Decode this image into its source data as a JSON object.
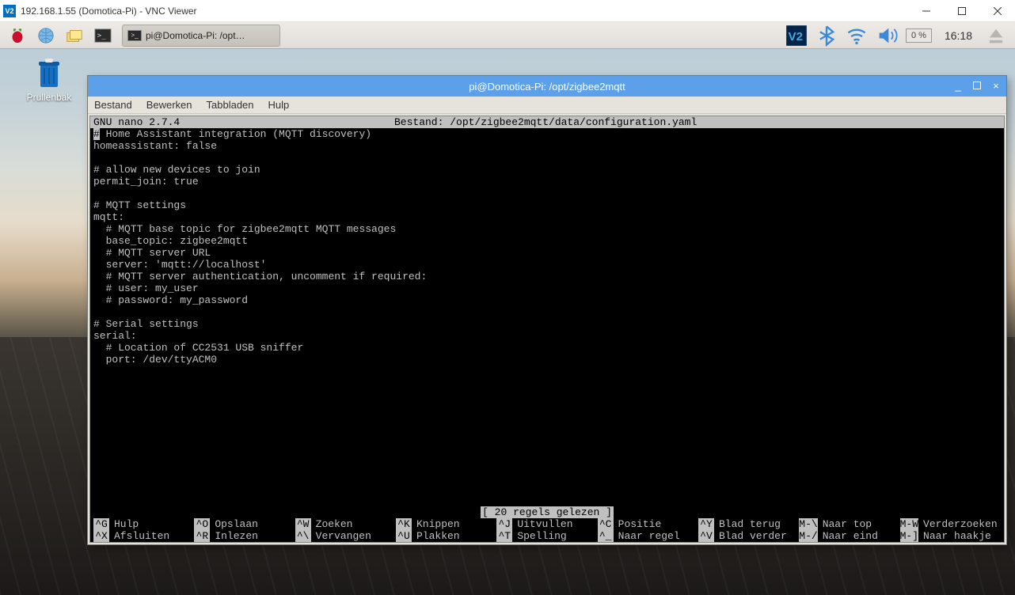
{
  "win_title": "192.168.1.55 (Domotica-Pi) - VNC Viewer",
  "taskbar": {
    "task_label": "pi@Domotica-Pi: /opt…",
    "cpu": "0 %",
    "clock": "16:18"
  },
  "desktop": {
    "trash_label": "Prullenbak"
  },
  "terminal": {
    "title": "pi@Domotica-Pi: /opt/zigbee2mqtt",
    "menu": [
      "Bestand",
      "Bewerken",
      "Tabbladen",
      "Hulp"
    ],
    "nano_version": "GNU nano 2.7.4",
    "nano_file": "Bestand: /opt/zigbee2mqtt/data/configuration.yaml",
    "lines": [
      "# Home Assistant integration (MQTT discovery)",
      "homeassistant: false",
      "",
      "# allow new devices to join",
      "permit_join: true",
      "",
      "# MQTT settings",
      "mqtt:",
      "  # MQTT base topic for zigbee2mqtt MQTT messages",
      "  base_topic: zigbee2mqtt",
      "  # MQTT server URL",
      "  server: 'mqtt://localhost'",
      "  # MQTT server authentication, uncomment if required:",
      "  # user: my_user",
      "  # password: my_password",
      "",
      "# Serial settings",
      "serial:",
      "  # Location of CC2531 USB sniffer",
      "  port: /dev/ttyACM0"
    ],
    "status": "[ 20 regels gelezen ]",
    "shortcuts": {
      "row1": [
        {
          "k": "^G",
          "l": "Hulp"
        },
        {
          "k": "^O",
          "l": "Opslaan"
        },
        {
          "k": "^W",
          "l": "Zoeken"
        },
        {
          "k": "^K",
          "l": "Knippen"
        },
        {
          "k": "^J",
          "l": "Uitvullen"
        },
        {
          "k": "^C",
          "l": "Positie"
        },
        {
          "k": "^Y",
          "l": "Blad terug"
        },
        {
          "k": "M-\\",
          "l": "Naar top"
        },
        {
          "k": "M-W",
          "l": "Verderzoeken"
        }
      ],
      "row2": [
        {
          "k": "^X",
          "l": "Afsluiten"
        },
        {
          "k": "^R",
          "l": "Inlezen"
        },
        {
          "k": "^\\",
          "l": "Vervangen"
        },
        {
          "k": "^U",
          "l": "Plakken"
        },
        {
          "k": "^T",
          "l": "Spelling"
        },
        {
          "k": "^_",
          "l": "Naar regel"
        },
        {
          "k": "^V",
          "l": "Blad verder"
        },
        {
          "k": "M-/",
          "l": "Naar eind"
        },
        {
          "k": "M-]",
          "l": "Naar haakje"
        }
      ]
    }
  }
}
